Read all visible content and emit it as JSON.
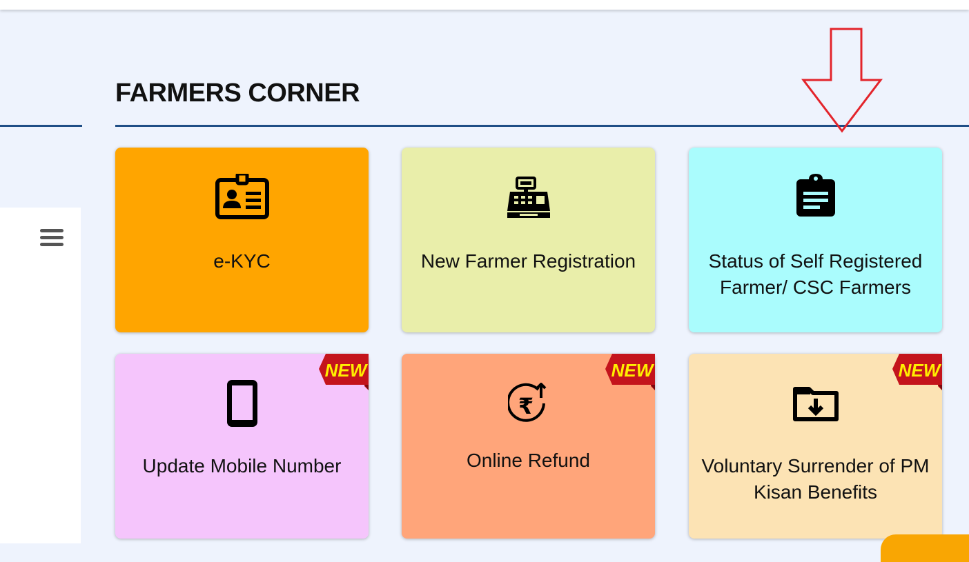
{
  "section": {
    "title": "FARMERS CORNER"
  },
  "badge": {
    "new_label": "NEW"
  },
  "cards": [
    {
      "label": "e-KYC",
      "icon": "id-card-icon",
      "color": "#ffa500"
    },
    {
      "label": "New Farmer Registration",
      "icon": "cash-register-icon",
      "color": "#e9eeaa"
    },
    {
      "label": "Status of Self Registered Farmer/ CSC Farmers",
      "icon": "clipboard-list-icon",
      "color": "#aafcfd"
    },
    {
      "label": "Update Mobile Number",
      "icon": "mobile-phone-icon",
      "color": "#f5c5fc",
      "new": true
    },
    {
      "label": "Online Refund",
      "icon": "rupee-refund-icon",
      "color": "#ffa57a",
      "new": true
    },
    {
      "label": "Voluntary Surrender of PM Kisan Benefits",
      "icon": "folder-download-icon",
      "color": "#fce3b4",
      "new": true
    }
  ],
  "colors": {
    "accent_rule": "#1f4e86",
    "page_bg": "#eef3fd",
    "badge_red": "#c4141c",
    "badge_text": "#ffee00",
    "arrow": "#e3242b"
  }
}
